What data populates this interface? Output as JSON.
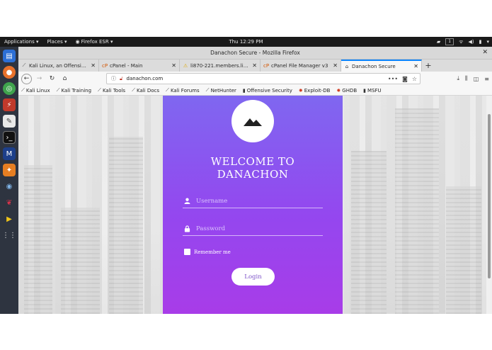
{
  "topbar": {
    "applications": "Applications ▾",
    "places": "Places ▾",
    "firefox": "Firefox ESR ▾",
    "clock": "Thu 12:29 PM",
    "workspace": "1"
  },
  "window": {
    "title": "Danachon Secure - Mozilla Firefox"
  },
  "tabs": [
    {
      "title": "Kali Linux, an Offensive Secu",
      "icon": "kali-dragon-icon"
    },
    {
      "title": "cPanel - Main",
      "icon": "cpanel-icon"
    },
    {
      "title": "li870-221.members.linod",
      "icon": "warning-icon"
    },
    {
      "title": "cPanel File Manager v3",
      "icon": "cpanel-icon"
    },
    {
      "title": "Danachon Secure",
      "icon": "home-icon"
    }
  ],
  "urlbar": {
    "url": "danachon.com"
  },
  "bookmarks": [
    {
      "label": "Kali Linux",
      "icon": "kali-dragon-icon"
    },
    {
      "label": "Kali Training",
      "icon": "kali-dragon-icon"
    },
    {
      "label": "Kali Tools",
      "icon": "kali-dragon-icon"
    },
    {
      "label": "Kali Docs",
      "icon": "kali-dragon-icon"
    },
    {
      "label": "Kali Forums",
      "icon": "kali-dragon-icon"
    },
    {
      "label": "NetHunter",
      "icon": "kali-dragon-icon"
    },
    {
      "label": "Offensive Security",
      "icon": "offsec-icon"
    },
    {
      "label": "Exploit-DB",
      "icon": "exploitdb-icon"
    },
    {
      "label": "GHDB",
      "icon": "exploitdb-icon"
    },
    {
      "label": "MSFU",
      "icon": "offsec-icon"
    }
  ],
  "login": {
    "welcome_line1": "WELCOME TO",
    "welcome_line2": "DANACHON",
    "username_placeholder": "Username",
    "password_placeholder": "Password",
    "remember_label": "Remember me",
    "login_button": "Login"
  },
  "colors": {
    "card_top": "#7f67f0",
    "card_bottom": "#a83ce8",
    "accent_tab": "#0a84ff"
  }
}
